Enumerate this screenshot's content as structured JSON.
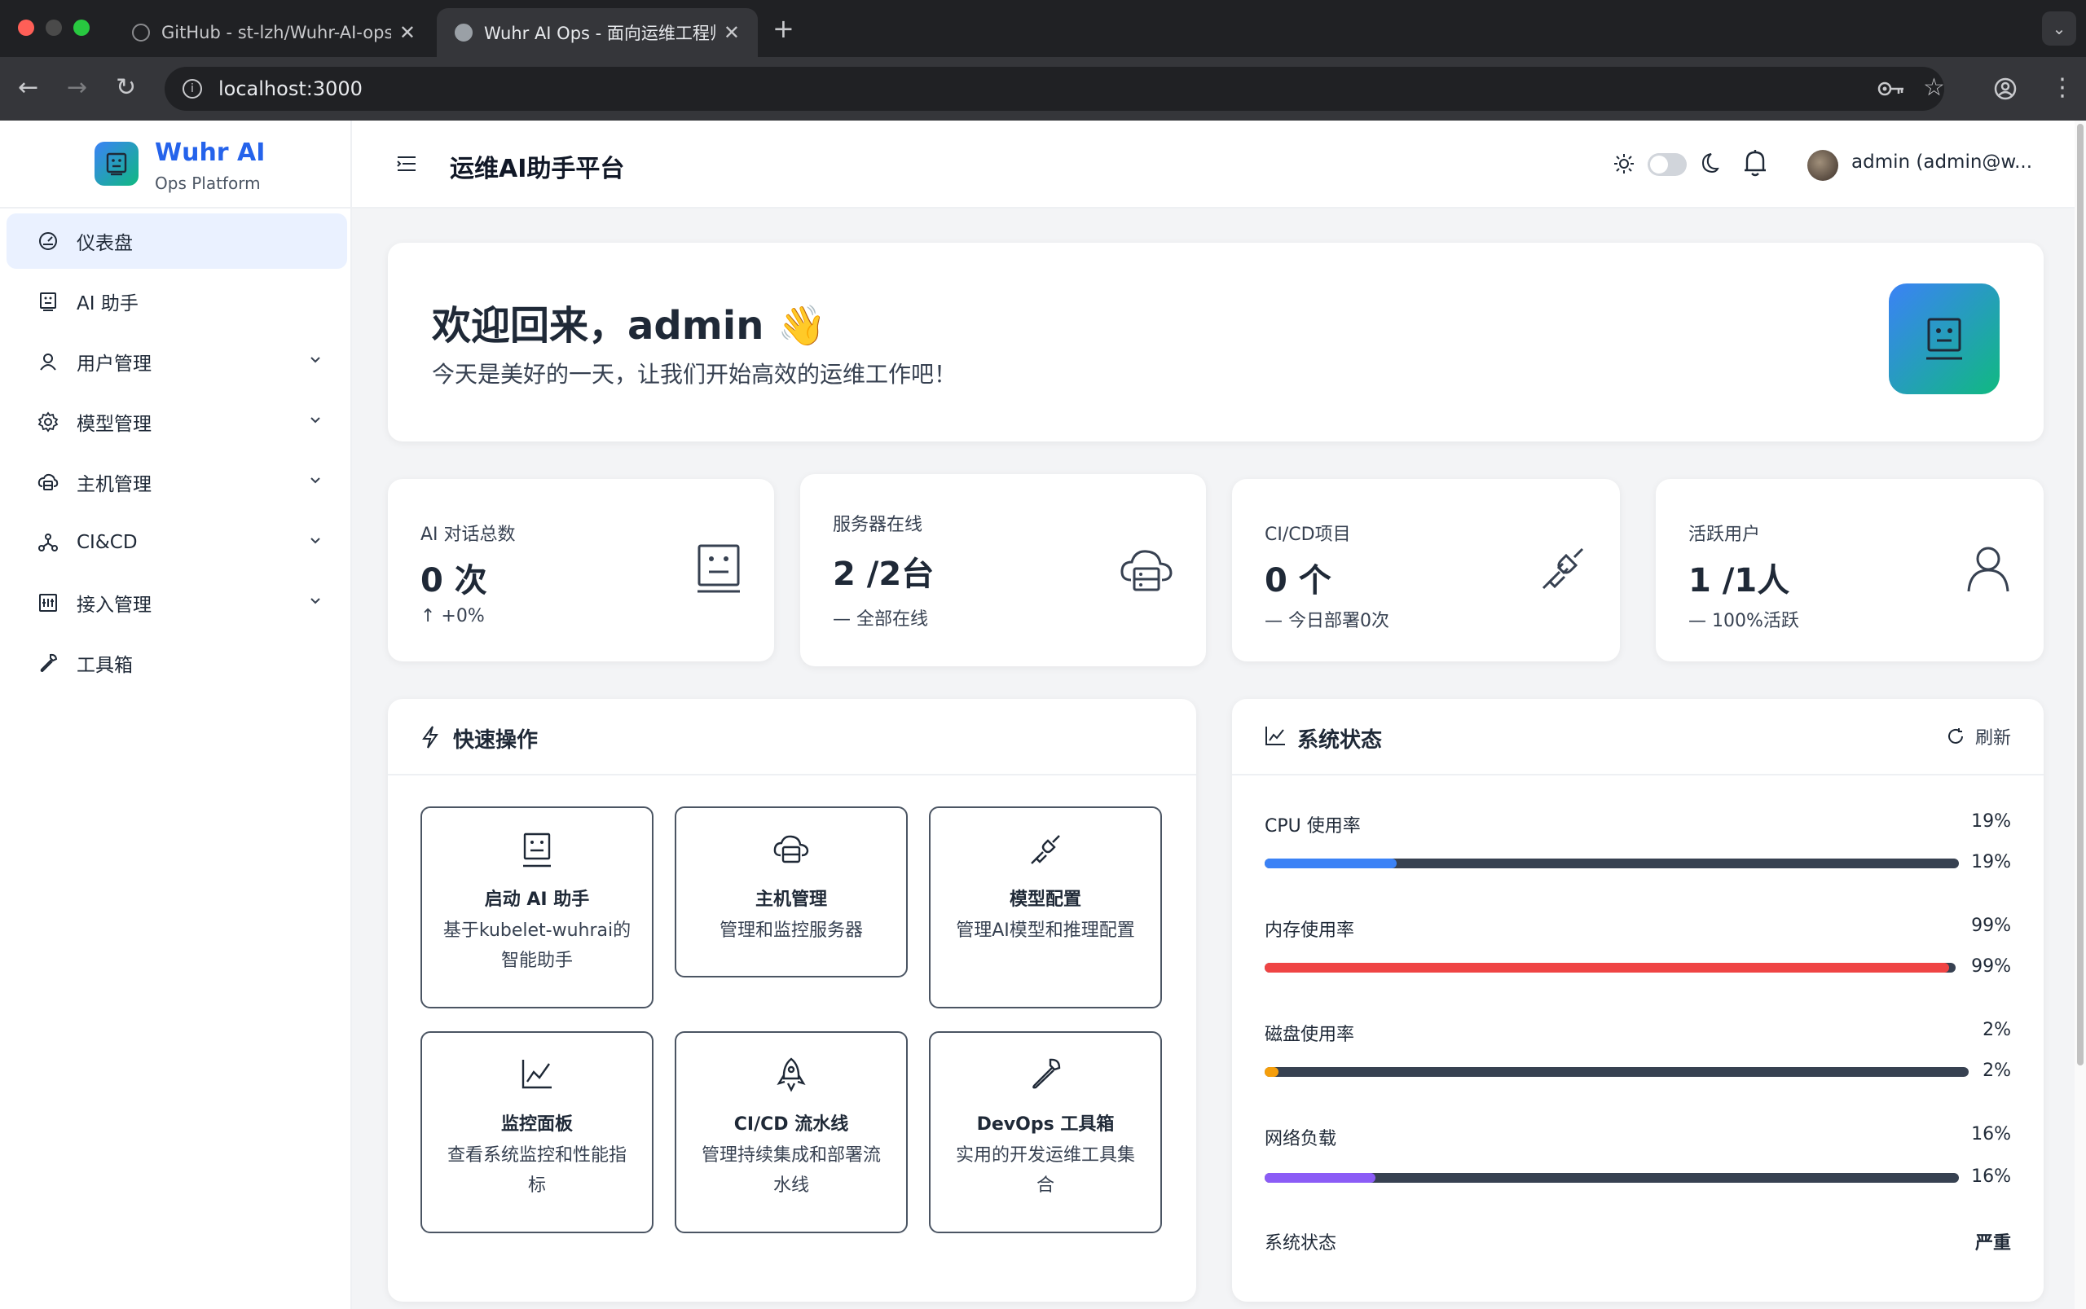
{
  "browser": {
    "tabs": [
      {
        "title": "GitHub - st-lzh/Wuhr-AI-ops: Wu",
        "active": false
      },
      {
        "title": "Wuhr AI Ops - 面向运维工程师",
        "active": true
      }
    ],
    "url": "localhost:3000"
  },
  "brand": {
    "name": "Wuhr AI",
    "subtitle": "Ops Platform"
  },
  "sidebar": {
    "items": [
      {
        "label": "仪表盘",
        "icon": "dashboard-icon",
        "active": true,
        "expandable": false
      },
      {
        "label": "AI 助手",
        "icon": "robot-icon",
        "active": false,
        "expandable": false
      },
      {
        "label": "用户管理",
        "icon": "user-icon",
        "active": false,
        "expandable": true
      },
      {
        "label": "模型管理",
        "icon": "gear-icon",
        "active": false,
        "expandable": true
      },
      {
        "label": "主机管理",
        "icon": "cloud-server-icon",
        "active": false,
        "expandable": true
      },
      {
        "label": "CI&CD",
        "icon": "deployment-unit-icon",
        "active": false,
        "expandable": true
      },
      {
        "label": "接入管理",
        "icon": "api-icon",
        "active": false,
        "expandable": true
      },
      {
        "label": "工具箱",
        "icon": "tool-icon",
        "active": false,
        "expandable": false
      }
    ]
  },
  "header": {
    "title": "运维AI助手平台",
    "user": "admin (admin@w..."
  },
  "welcome": {
    "greeting": "欢迎回来，admin 👋",
    "subtitle": "今天是美好的一天，让我们开始高效的运维工作吧！"
  },
  "stats": [
    {
      "label": "AI 对话总数",
      "value": "0 次",
      "sub": "↑ +0%",
      "icon": "robot-icon"
    },
    {
      "label": "服务器在线",
      "value": "2 /2台",
      "sub": "— 全部在线",
      "icon": "cloud-server-icon"
    },
    {
      "label": "CI/CD项目",
      "value": "0 个",
      "sub": "— 今日部署0次",
      "icon": "api-plug-icon"
    },
    {
      "label": "活跃用户",
      "value": "1 /1人",
      "sub": "— 100%活跃",
      "icon": "user-icon"
    }
  ],
  "quick_actions": {
    "title": "快速操作",
    "items": [
      {
        "title": "启动 AI 助手",
        "desc": "基于kubelet-wuhrai的智能助手",
        "icon": "robot-icon"
      },
      {
        "title": "主机管理",
        "desc": "管理和监控服务器",
        "icon": "cloud-server-icon"
      },
      {
        "title": "模型配置",
        "desc": "管理AI模型和推理配置",
        "icon": "api-plug-icon"
      },
      {
        "title": "监控面板",
        "desc": "查看系统监控和性能指标",
        "icon": "line-chart-icon"
      },
      {
        "title": "CI/CD 流水线",
        "desc": "管理持续集成和部署流水线",
        "icon": "rocket-icon"
      },
      {
        "title": "DevOps 工具箱",
        "desc": "实用的开发运维工具集合",
        "icon": "tool-icon"
      }
    ]
  },
  "system_status": {
    "title": "系统状态",
    "refresh_label": "刷新",
    "metrics": [
      {
        "label": "CPU 使用率",
        "value": "19%",
        "percent": 19,
        "color": "#3b82f6"
      },
      {
        "label": "内存使用率",
        "value": "99%",
        "percent": 99,
        "color": "#ef4444"
      },
      {
        "label": "磁盘使用率",
        "value": "2%",
        "percent": 2,
        "color": "#f59e0b"
      },
      {
        "label": "网络负载",
        "value": "16%",
        "percent": 16,
        "color": "#8b5cf6"
      }
    ],
    "status_label": "系统状态",
    "status_value": "严重"
  }
}
